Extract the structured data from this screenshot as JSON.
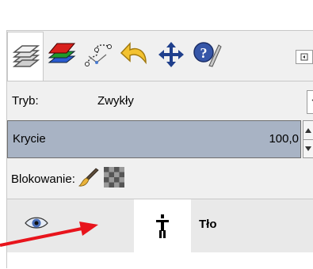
{
  "tabs": [
    {
      "icon": "layers-icon",
      "active": true
    },
    {
      "icon": "channels-icon",
      "active": false
    },
    {
      "icon": "paths-icon",
      "active": false
    },
    {
      "icon": "undo-history-icon",
      "active": false
    },
    {
      "icon": "move-icon",
      "active": false
    },
    {
      "icon": "brushes-icon",
      "active": false
    }
  ],
  "mode": {
    "label": "Tryb:",
    "value": "Zwykły"
  },
  "opacity": {
    "label": "Krycie",
    "value": "100,0"
  },
  "lock": {
    "label": "Blokowanie:"
  },
  "layers": [
    {
      "name": "Tło",
      "visible": true
    }
  ],
  "colors": {
    "opacity_bar": "#a8b3c4",
    "arrow": "#e8141c",
    "panel_bg": "#f0f0f0"
  }
}
